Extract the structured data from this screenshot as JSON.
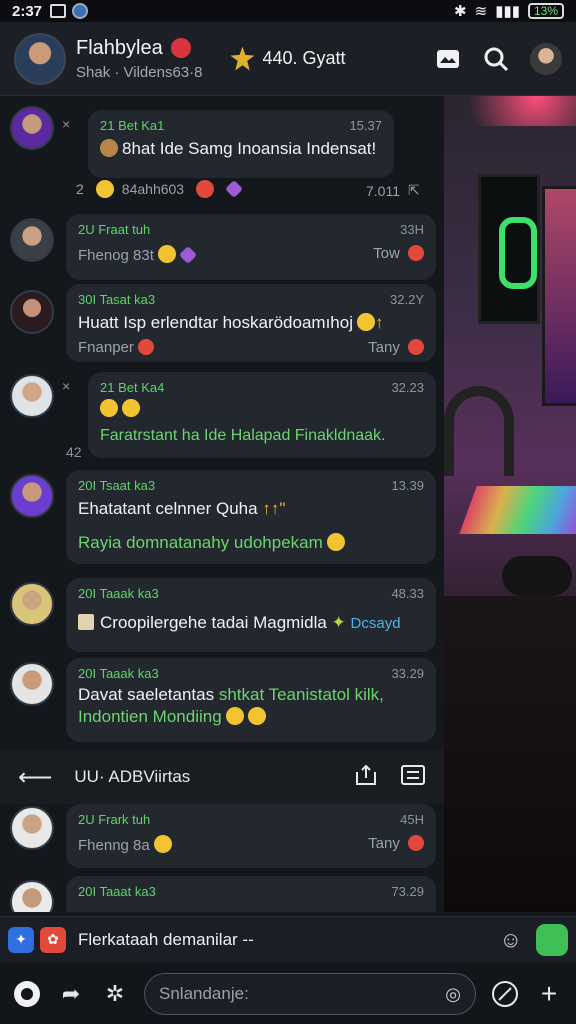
{
  "status": {
    "time": "2:37",
    "battery": "13%"
  },
  "header": {
    "name": "Flahbylea",
    "subtitle": "Shak · Vildens63·8",
    "badge": "440. Gyatt"
  },
  "messages": [
    {
      "who": "21 Bet Ka1",
      "ts": "15.37",
      "text": "8hat Ide Samg Inoansia Indensat!",
      "green": false,
      "foot_left": "",
      "foot_right": ""
    },
    {
      "who": "2U Fraat tuh",
      "ts": "33H",
      "text": "",
      "green": false,
      "foot_left": "Fhenog 83t",
      "foot_right": "Tow"
    },
    {
      "who": "30I Tasat ka3",
      "ts": "32.2Y",
      "text": "Huatt Isp erlendtar hoskarödoamıhoj",
      "green": false,
      "foot_left": "Fnanper",
      "foot_right": "Tany"
    },
    {
      "who": "21 Bet Ka4",
      "ts": "32.23",
      "text": "Faratrstant ha Ide Halapad Finakldnaak.",
      "green": true,
      "foot_left": "",
      "foot_right": ""
    },
    {
      "who": "20I Tsaat ka3",
      "ts": "13.39",
      "text": "Ehatatant celnner Quha",
      "green": false,
      "text2": "Rayia domnatanahy udohpekam",
      "foot_left": "",
      "foot_right": ""
    },
    {
      "who": "20I Taaak ka3",
      "ts": "48.33",
      "text": "Croopilergehe tadai Magmidla",
      "green": false,
      "tag": "Dcsayd",
      "foot_left": "",
      "foot_right": ""
    },
    {
      "who": "20I Taaak ka3",
      "ts": "33.29",
      "text": "Davat saeletantas",
      "text_g": "shtkat Teanistatol kilk,",
      "text2": "Indontien Mondiing",
      "green": false,
      "foot_left": "",
      "foot_right": ""
    }
  ],
  "side_marks": {
    "m1": "×",
    "m2": "2",
    "m3": "×",
    "m4": "42"
  },
  "reaction_line": {
    "label": "84ahh603",
    "time": "7.011"
  },
  "thread": {
    "title": "UU·  ADBViirtas"
  },
  "messages2": [
    {
      "who": "2U Frark tuh",
      "ts": "45H",
      "foot_left": "Fhenng 8a",
      "foot_right": "Tany"
    },
    {
      "who": "20I Taaat ka3",
      "ts": "73.29"
    }
  ],
  "notification": {
    "text": "Flerkataah demanilar  --"
  },
  "composer": {
    "placeholder": "Snlandanje:"
  }
}
